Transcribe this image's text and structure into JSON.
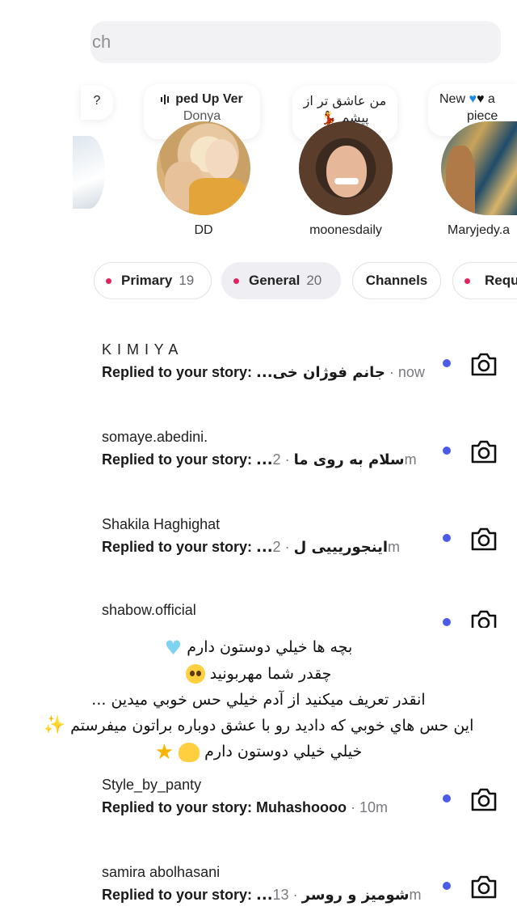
{
  "search": {
    "placeholder_fragment": "ch"
  },
  "notes": [
    {
      "text": "?"
    },
    {
      "music_title": "ped Up Ver",
      "artist": "Donya"
    },
    {
      "line1": "من عاشق تر از",
      "line2": "پیشم"
    },
    {
      "line1": "New",
      "line1_tail": "a",
      "line2": "piece"
    }
  ],
  "stories": [
    {
      "name": "DD"
    },
    {
      "name": "moonesdaily"
    },
    {
      "name": "Maryjedy.a"
    }
  ],
  "tabs": [
    {
      "label": "Primary",
      "count": "19"
    },
    {
      "label": "General",
      "count": "20"
    },
    {
      "label": "Channels"
    },
    {
      "label": "Requ"
    }
  ],
  "messages": [
    {
      "name": "K I M I Y A",
      "prefix": "Replied to your story: ",
      "text": "...جانم فوژان خی",
      "time": "now"
    },
    {
      "name": "somaye.abedini.",
      "prefix": "Replied to your story: ",
      "text": "...سلام به روی ما",
      "time": "2m"
    },
    {
      "name": "Shakila Haghighat",
      "prefix": "Replied to your story: ",
      "text": "...اینجوریییی ل",
      "time": "2m"
    },
    {
      "name": "shabow.official"
    },
    {
      "name": "Style_by_panty",
      "prefix": "Replied to your story: ",
      "text": "Muhashoooo",
      "time": "10m"
    },
    {
      "name": "samira abolhasani",
      "prefix": "Replied to your story: ",
      "text": "...شومیز و روسر",
      "time": "13m"
    }
  ],
  "caption": {
    "line1": "بچه ها خيلي دوستون دارم",
    "line2": "چقدر شما مهربونيد",
    "line3": "انقدر تعريف ميكنيد از آدم خيلي حس خوبي ميدين ...",
    "line4": "اين حس هاي خوبي كه داديد رو با عشق دوباره براتون ميفرستم",
    "line5": "خيلي خيلي دوستون دارم"
  },
  "colors": {
    "unread_dot": "#4a5ce5",
    "tab_dot": "#e0245e"
  }
}
